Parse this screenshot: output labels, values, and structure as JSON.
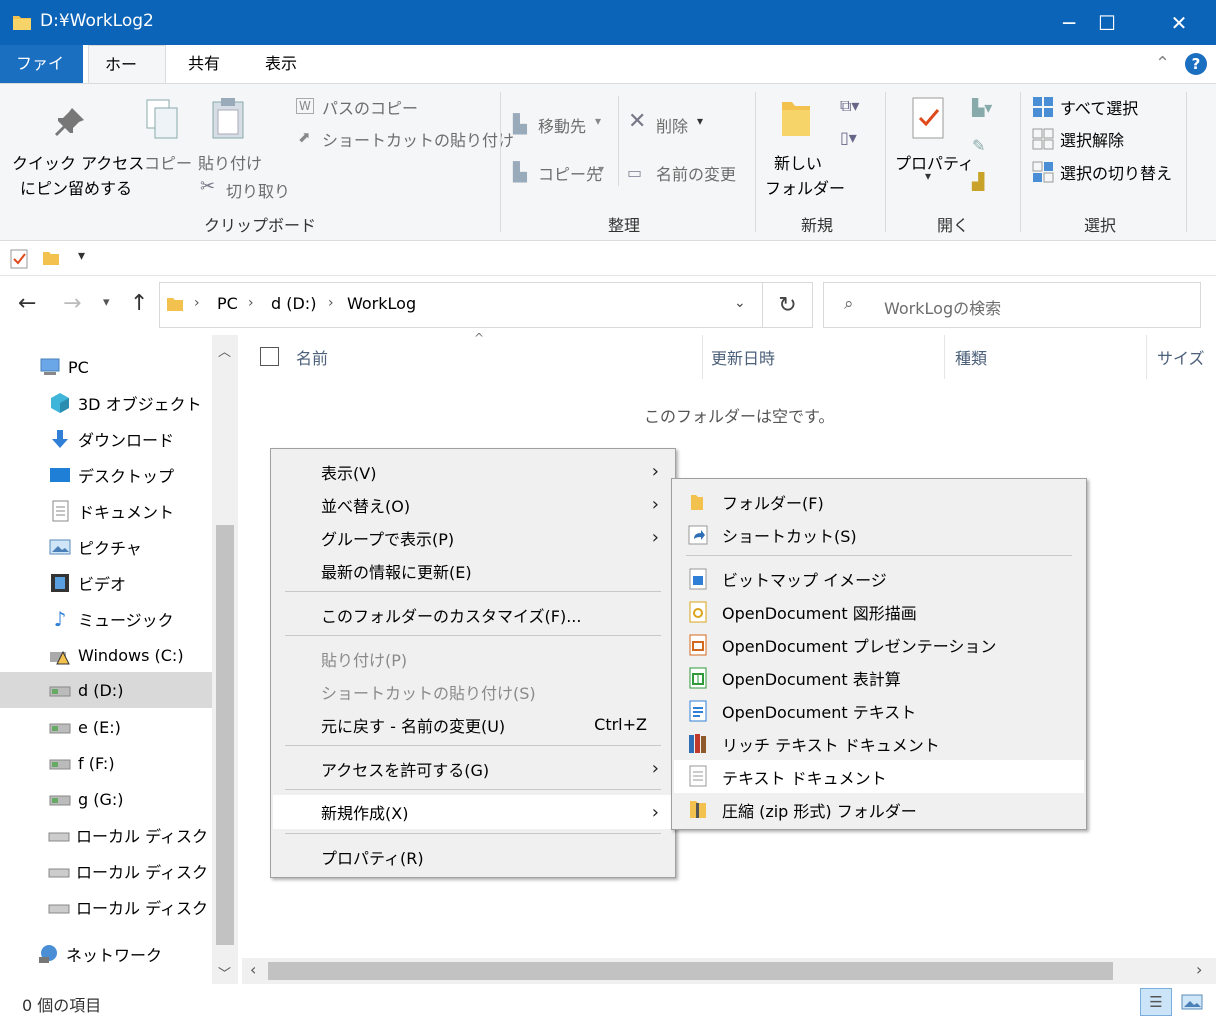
{
  "window": {
    "title": "D:¥WorkLog2",
    "minimize": "─",
    "maximize": "☐",
    "close": "✕"
  },
  "ribbon_tabs": [
    {
      "label": "ファイル"
    },
    {
      "label": "ホーム"
    },
    {
      "label": "共有"
    },
    {
      "label": "表示"
    }
  ],
  "ribbon": {
    "pin_line1": "クイック アクセス",
    "pin_line2": "にピン留めする",
    "copy": "コピー",
    "paste": "貼り付け",
    "copy_path": "パスのコピー",
    "paste_shortcut": "ショートカットの貼り付け",
    "cut": "切り取り",
    "group_clipboard": "クリップボード",
    "move_to": "移動先",
    "copy_to": "コピー先",
    "delete": "削除",
    "rename": "名前の変更",
    "group_organize": "整理",
    "new_folder_line1": "新しい",
    "new_folder_line2": "フォルダー",
    "group_new": "新規",
    "properties": "プロパティ",
    "group_open": "開く",
    "select_all": "すべて選択",
    "select_none": "選択解除",
    "invert_selection": "選択の切り替え",
    "group_select": "選択"
  },
  "address": {
    "path": [
      "PC",
      "d (D:)",
      "WorkLog"
    ],
    "search_placeholder": "WorkLogの検索"
  },
  "nav": [
    {
      "label": "PC",
      "icon": "pc-icon"
    },
    {
      "label": "3D オブジェクト",
      "icon": "3d-objects-icon"
    },
    {
      "label": "ダウンロード",
      "icon": "download-icon"
    },
    {
      "label": "デスクトップ",
      "icon": "desktop-icon"
    },
    {
      "label": "ドキュメント",
      "icon": "documents-icon"
    },
    {
      "label": "ピクチャ",
      "icon": "pictures-icon"
    },
    {
      "label": "ビデオ",
      "icon": "videos-icon"
    },
    {
      "label": "ミュージック",
      "icon": "music-icon"
    },
    {
      "label": "Windows (C:)",
      "icon": "system-drive-icon"
    },
    {
      "label": "d (D:)",
      "icon": "drive-icon"
    },
    {
      "label": "e (E:)",
      "icon": "drive-icon"
    },
    {
      "label": "f (F:)",
      "icon": "drive-icon"
    },
    {
      "label": "g (G:)",
      "icon": "drive-icon"
    },
    {
      "label": "ローカル ディスク (H:)",
      "icon": "disk-icon"
    },
    {
      "label": "ローカル ディスク (I:)",
      "icon": "disk-icon"
    },
    {
      "label": "ローカル ディスク (J:)",
      "icon": "disk-icon"
    },
    {
      "label": "ネットワーク",
      "icon": "network-icon"
    }
  ],
  "columns": {
    "name": "名前",
    "modified": "更新日時",
    "type": "種類",
    "size": "サイズ"
  },
  "empty_message": "このフォルダーは空です。",
  "context_menu": [
    {
      "label": "表示(V)",
      "submenu": true
    },
    {
      "label": "並べ替え(O)",
      "submenu": true
    },
    {
      "label": "グループで表示(P)",
      "submenu": true
    },
    {
      "label": "最新の情報に更新(E)"
    },
    {
      "label": "このフォルダーのカスタマイズ(F)..."
    },
    {
      "label": "貼り付け(P)",
      "disabled": true
    },
    {
      "label": "ショートカットの貼り付け(S)",
      "disabled": true
    },
    {
      "label": "元に戻す - 名前の変更(U)",
      "shortcut": "Ctrl+Z"
    },
    {
      "label": "アクセスを許可する(G)",
      "submenu": true
    },
    {
      "label": "新規作成(X)",
      "submenu": true,
      "highlighted": true
    },
    {
      "label": "プロパティ(R)"
    }
  ],
  "submenu_new": [
    {
      "label": "フォルダー(F)",
      "icon": "folder-icon"
    },
    {
      "label": "ショートカット(S)",
      "icon": "shortcut-icon"
    },
    {
      "label": "ビットマップ イメージ",
      "icon": "bitmap-icon"
    },
    {
      "label": "OpenDocument 図形描画",
      "icon": "odg-icon"
    },
    {
      "label": "OpenDocument プレゼンテーション",
      "icon": "odp-icon"
    },
    {
      "label": "OpenDocument 表計算",
      "icon": "ods-icon"
    },
    {
      "label": "OpenDocument テキスト",
      "icon": "odt-icon"
    },
    {
      "label": "リッチ テキスト ドキュメント",
      "icon": "rtf-icon"
    },
    {
      "label": "テキスト ドキュメント",
      "icon": "txt-icon",
      "highlighted": true
    },
    {
      "label": "圧縮 (zip 形式) フォルダー",
      "icon": "zip-folder-icon"
    }
  ],
  "status": {
    "item_count": "0 個の項目"
  },
  "colors": {
    "titlebar": "#0c64b8",
    "folder": "#f2c14e",
    "accent": "#1a6fc0"
  }
}
